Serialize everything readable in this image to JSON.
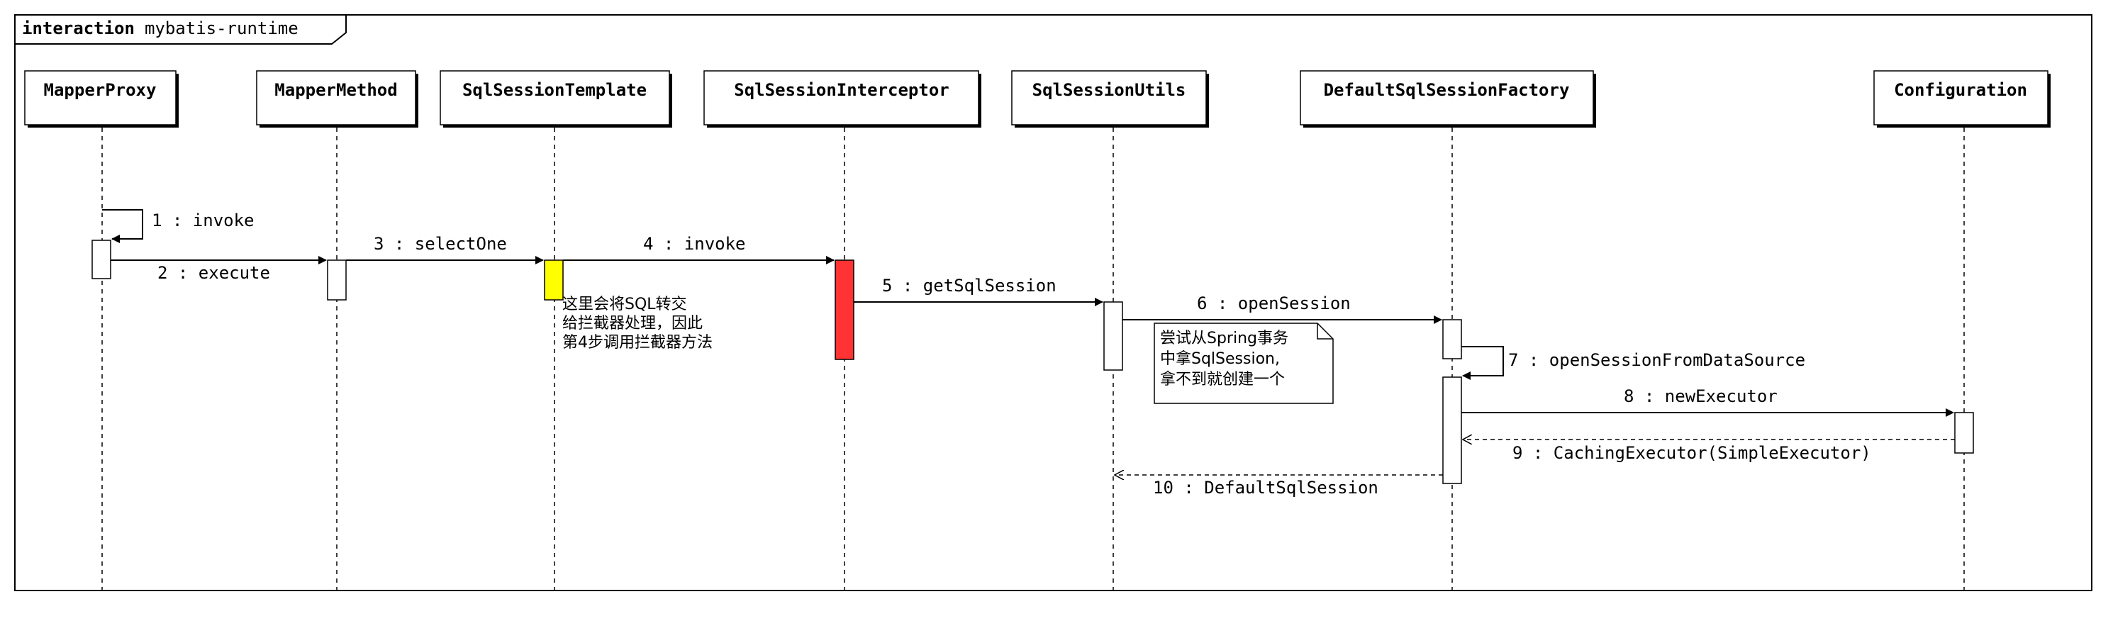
{
  "frame": {
    "keyword": "interaction",
    "name": "mybatis-runtime"
  },
  "participants": [
    {
      "id": "mapper-proxy",
      "label": "MapperProxy"
    },
    {
      "id": "mapper-method",
      "label": "MapperMethod"
    },
    {
      "id": "sql-session-template",
      "label": "SqlSessionTemplate"
    },
    {
      "id": "sql-session-interceptor",
      "label": "SqlSessionInterceptor"
    },
    {
      "id": "sql-session-utils",
      "label": "SqlSessionUtils"
    },
    {
      "id": "default-sql-session-factory",
      "label": "DefaultSqlSessionFactory"
    },
    {
      "id": "configuration",
      "label": "Configuration"
    }
  ],
  "messages": [
    {
      "label": "1 : invoke",
      "type": "self"
    },
    {
      "label": "2 : execute",
      "type": "sync"
    },
    {
      "label": "3 : selectOne",
      "type": "sync"
    },
    {
      "label": "4 : invoke",
      "type": "sync"
    },
    {
      "label": "5 : getSqlSession",
      "type": "sync"
    },
    {
      "label": "6 : openSession",
      "type": "sync"
    },
    {
      "label": "7 : openSessionFromDataSource",
      "type": "self"
    },
    {
      "label": "8 : newExecutor",
      "type": "sync"
    },
    {
      "label": "9 : CachingExecutor(SimpleExecutor)",
      "type": "return"
    },
    {
      "label": "10 : DefaultSqlSession",
      "type": "return"
    }
  ],
  "notes": [
    {
      "lines": [
        "这里会将SQL转交",
        "给拦截器处理，因此",
        "第4步调用拦截器方法"
      ]
    },
    {
      "lines": [
        "尝试从Spring事务",
        "中拿SqlSession,",
        "拿不到就创建一个"
      ]
    }
  ],
  "colors": {
    "template_activation": "#ffff00",
    "interceptor_activation": "#ff3333"
  }
}
